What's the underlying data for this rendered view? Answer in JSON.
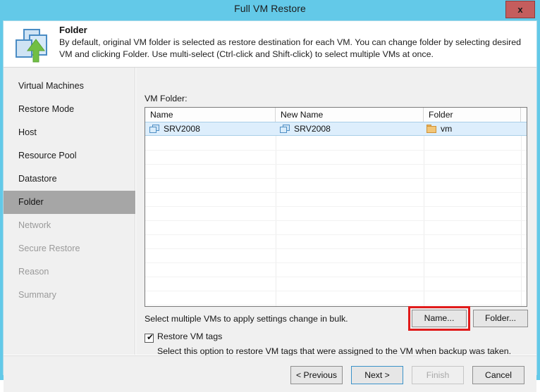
{
  "window": {
    "title": "Full VM Restore",
    "close_label": "x"
  },
  "header": {
    "title": "Folder",
    "description": "By default, original VM folder is selected as restore destination for each VM. You can change folder by selecting desired VM and clicking Folder. Use multi-select (Ctrl-click and Shift-click) to select multiple VMs at once.",
    "icon": "vm-folder-restore-icon"
  },
  "sidebar": {
    "items": [
      {
        "label": "Virtual Machines",
        "state": "enabled"
      },
      {
        "label": "Restore Mode",
        "state": "enabled"
      },
      {
        "label": "Host",
        "state": "enabled"
      },
      {
        "label": "Resource Pool",
        "state": "enabled"
      },
      {
        "label": "Datastore",
        "state": "enabled"
      },
      {
        "label": "Folder",
        "state": "active"
      },
      {
        "label": "Network",
        "state": "disabled"
      },
      {
        "label": "Secure Restore",
        "state": "disabled"
      },
      {
        "label": "Reason",
        "state": "disabled"
      },
      {
        "label": "Summary",
        "state": "disabled"
      }
    ]
  },
  "main": {
    "list_label": "VM Folder:",
    "table": {
      "columns": [
        "Name",
        "New Name",
        "Folder"
      ],
      "rows": [
        {
          "name": "SRV2008",
          "new_name": "SRV2008",
          "folder": "vm",
          "name_icon": "vm-icon",
          "new_name_icon": "vm-icon",
          "folder_icon": "folder-icon",
          "selected": true
        }
      ]
    },
    "bulk_hint": "Select multiple VMs to apply settings change in bulk.",
    "name_button": "Name...",
    "folder_button": "Folder...",
    "checkbox": {
      "label": "Restore VM tags",
      "checked": true,
      "check_glyph": "✔",
      "description": "Select this option to restore VM tags that were assigned to the VM when backup was taken."
    }
  },
  "footer": {
    "previous": "< Previous",
    "next": "Next >",
    "finish": "Finish",
    "cancel": "Cancel"
  },
  "colors": {
    "titlebar": "#63c9e8",
    "close_button": "#c45d5d",
    "sidebar_active": "#a6a6a6",
    "row_selected": "#ddeefc",
    "highlight_annotation": "#e01b1b",
    "focus_border": "#3b92c9"
  }
}
